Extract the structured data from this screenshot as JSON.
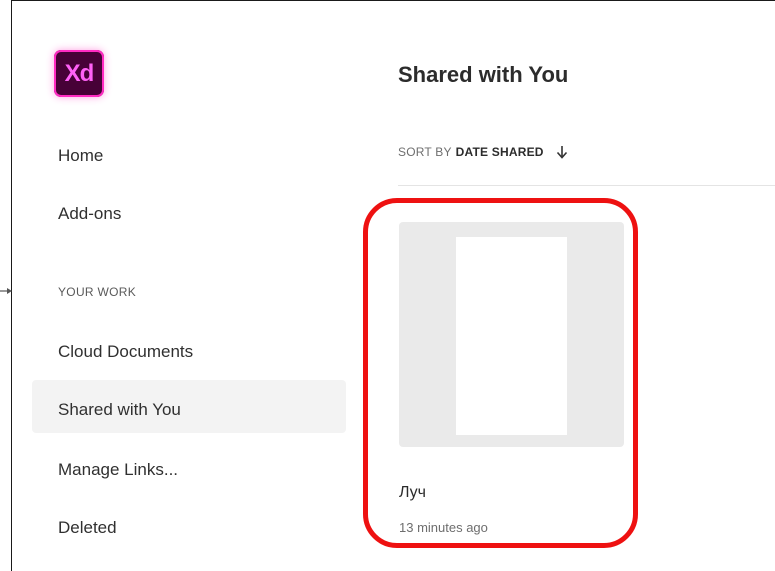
{
  "app": {
    "logo_text": "Xd",
    "brand_color": "#470137",
    "logo_accent": "#ff61f6"
  },
  "sidebar": {
    "items": [
      {
        "label": "Home"
      },
      {
        "label": "Add-ons"
      }
    ],
    "section_label": "YOUR WORK",
    "work_items": [
      {
        "label": "Cloud Documents"
      },
      {
        "label": "Shared with You",
        "active": true
      },
      {
        "label": "Manage Links..."
      },
      {
        "label": "Deleted"
      }
    ]
  },
  "main": {
    "title": "Shared with You",
    "sort": {
      "prefix": "SORT BY",
      "value": "DATE SHARED",
      "direction_icon": "arrow-down-icon"
    },
    "documents": [
      {
        "name": "Луч",
        "time": "13 minutes ago"
      }
    ]
  },
  "annotation": {
    "highlight_color": "#ee1111"
  }
}
